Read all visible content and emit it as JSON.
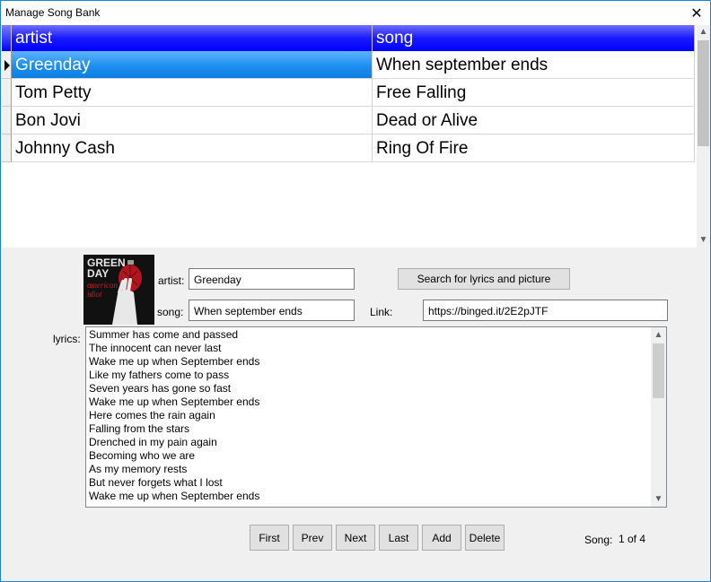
{
  "window": {
    "title": "Manage Song Bank",
    "close_glyph": "✕"
  },
  "grid": {
    "columns": [
      "artist",
      "song"
    ],
    "rows": [
      {
        "artist": "Greenday",
        "song": "When september ends",
        "selected": true
      },
      {
        "artist": "Tom Petty",
        "song": "Free Falling",
        "selected": false
      },
      {
        "artist": "Bon Jovi",
        "song": "Dead or Alive",
        "selected": false
      },
      {
        "artist": "Johnny Cash",
        "song": "Ring Of Fire",
        "selected": false
      }
    ],
    "colors": {
      "header": "#0000ff",
      "selected_row": "#1e8ff0"
    }
  },
  "album_art": {
    "icon": "album-cover-green-day-american-idiot",
    "text_lines": [
      "GREEN",
      "DAY",
      "american",
      "idiot"
    ]
  },
  "form": {
    "artist_label": "artist:",
    "artist_value": "Greenday",
    "song_label": "song:",
    "song_value": "When september ends",
    "link_label": "Link:",
    "link_value": "https://binged.it/2E2pJTF",
    "search_button": "Search for lyrics and picture",
    "lyrics_label": "lyrics:",
    "lyrics_lines": [
      "Summer has come and passed",
      "The innocent can never last",
      "Wake me up when September ends",
      "Like my fathers come to pass",
      "Seven years has gone so fast",
      "Wake me up when September ends",
      "Here comes the rain again",
      "Falling from the stars",
      "Drenched in my pain again",
      "Becoming who we are",
      "As my memory rests",
      "But never forgets what I lost",
      "Wake me up when September ends"
    ]
  },
  "nav": {
    "first": "First",
    "prev": "Prev",
    "next": "Next",
    "last": "Last",
    "add": "Add",
    "delete": "Delete",
    "song_label": "Song:",
    "position": "1 of 4"
  }
}
